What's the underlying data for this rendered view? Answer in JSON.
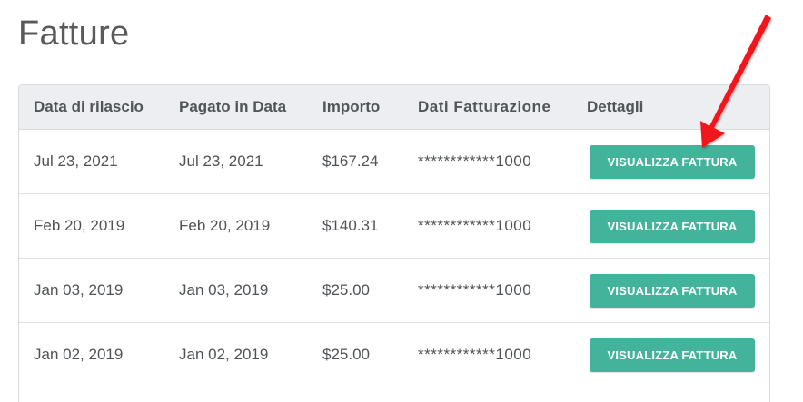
{
  "page": {
    "title": "Fatture"
  },
  "table": {
    "headers": [
      "Data di rilascio",
      "Pagato in Data",
      "Importo",
      "Dati Fatturazione",
      "Dettagli"
    ],
    "rows": [
      {
        "issued": "Jul 23, 2021",
        "paid": "Jul 23, 2021",
        "amount": "$167.24",
        "billing": "************1000",
        "action": "VISUALIZZA FATTURA"
      },
      {
        "issued": "Feb 20, 2019",
        "paid": "Feb 20, 2019",
        "amount": "$140.31",
        "billing": "************1000",
        "action": "VISUALIZZA FATTURA"
      },
      {
        "issued": "Jan 03, 2019",
        "paid": "Jan 03, 2019",
        "amount": "$25.00",
        "billing": "************1000",
        "action": "VISUALIZZA FATTURA"
      },
      {
        "issued": "Jan 02, 2019",
        "paid": "Jan 02, 2019",
        "amount": "$25.00",
        "billing": "************1000",
        "action": "VISUALIZZA FATTURA"
      }
    ]
  },
  "annotation": {
    "arrow_color": "#f0141e",
    "target": "first VISUALIZZA FATTURA button"
  },
  "colors": {
    "button": "#44b39b",
    "header_bg": "#eceef1"
  }
}
